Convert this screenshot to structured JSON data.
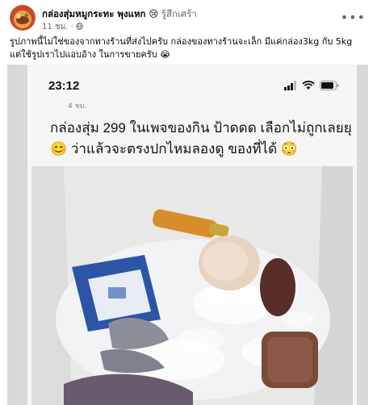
{
  "post": {
    "author": "กล่องสุ่มหมูกระทะ พุงแหก",
    "feeling_emoji": "😢",
    "feeling": "รู้สึกเศร้า",
    "time": "11 ชม.",
    "time_sep": "·",
    "privacy_icon": "globe-icon",
    "more_icon": "more-horizontal-icon",
    "caption_line1": "รูปภาพนี้ไม่ใช่ของจากทางร้านที่ส่งไปครับ กล่องของทางร้านจะเล็ก มีแค่กล่อง3kg กับ 5kg",
    "caption_line2": "แต่ใช้รูปเราไปแอบอ้าง ในการขายครับ 😭"
  },
  "photo": {
    "status_time": "23:12",
    "faded_text": "4 ชม.",
    "status_icons": [
      "signal-icon",
      "wifi-icon",
      "battery-icon"
    ],
    "quoted_line1": "กล่องสุ่ม 299 ในเพจของกิน ป้าดดด เลือกไม่ถูกเลยยุ",
    "quoted_line2": "😊 ว่าแล้วจะตรงปกไหมลองดู ของที่ได้ 😳"
  },
  "colors": {
    "text": "#050505",
    "meta": "#65676b",
    "background": "#ffffff"
  }
}
